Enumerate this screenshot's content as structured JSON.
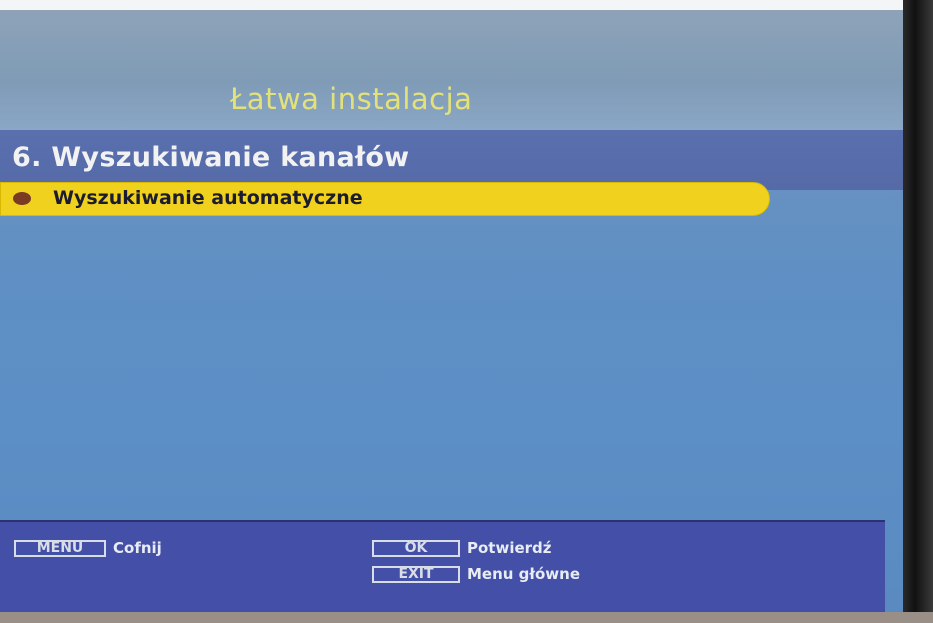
{
  "screen": {
    "title": "Łatwa instalacja",
    "section_title": "6. Wyszukiwanie kanałów",
    "menu_items": [
      {
        "label": "Wyszukiwanie automatyczne",
        "selected": true
      }
    ]
  },
  "footer": {
    "keys": [
      {
        "key": "MENU",
        "action": "Cofnij"
      },
      {
        "key": "OK",
        "action": "Potwierdź"
      },
      {
        "key": "EXIT",
        "action": "Menu główne"
      }
    ]
  },
  "colors": {
    "title": "#e3e27a",
    "highlight": "#f0d21e",
    "footer": "#4450a8"
  }
}
